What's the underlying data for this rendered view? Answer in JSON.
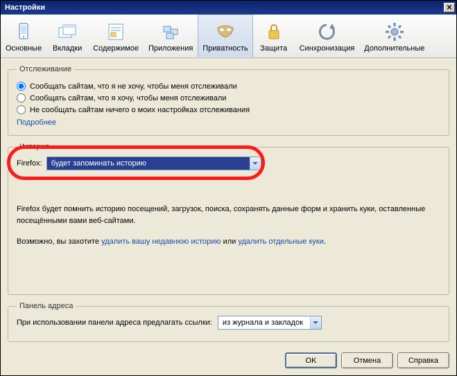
{
  "window": {
    "title": "Настройки"
  },
  "tabs": {
    "general": "Основные",
    "tabs": "Вкладки",
    "content": "Содержимое",
    "apps": "Приложения",
    "privacy": "Приватность",
    "security": "Защита",
    "sync": "Синхронизация",
    "advanced": "Дополнительные"
  },
  "tracking": {
    "legend": "Отслеживание",
    "opt1": "Сообщать сайтам, что я не хочу, чтобы меня отслеживали",
    "opt2": "Сообщать сайтам, что я хочу, чтобы меня отслеживали",
    "opt3": "Не сообщать сайтам ничего о моих настройках отслеживания",
    "more": "Подробнее"
  },
  "history": {
    "legend": "История",
    "label": "Firefox:",
    "value": "будет запоминать историю",
    "desc": "Firefox будет помнить историю посещений, загрузок, поиска, сохранять данные форм и хранить куки, оставленные посещёнными вами веб-сайтами.",
    "desc2_a": "Возможно, вы захотите ",
    "desc2_link1": "удалить вашу недавнюю историю",
    "desc2_b": " или ",
    "desc2_link2": "удалить отдельные куки",
    "desc2_c": "."
  },
  "addressbar": {
    "legend": "Панель адреса",
    "label": "При использовании панели адреса предлагать ссылки:",
    "value": "из журнала и закладок"
  },
  "buttons": {
    "ok": "OK",
    "cancel": "Отмена",
    "help": "Справка"
  }
}
